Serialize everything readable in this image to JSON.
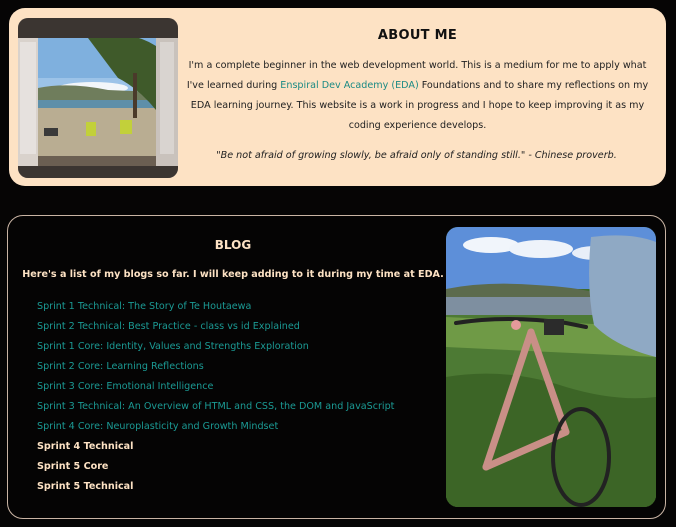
{
  "about": {
    "title": "ABOUT ME",
    "text_before_link": "I'm a complete beginner in the web development world. This is a medium for me to apply what I've learned during ",
    "link_text": "Enspiral Dev Academy (EDA)",
    "text_after_link": " Foundations and to share my reflections on my EDA learning journey. This website is a work in progress and I hope to keep improving it as my coding experience develops.",
    "quote": "\"Be not afraid of growing slowly, be afraid only of standing still.\" - Chinese proverb."
  },
  "blog": {
    "title": "BLOG",
    "intro": "Here's a list of my blogs so far. I will keep adding to it during my time at EDA.",
    "items": [
      {
        "label": "Sprint 1 Technical: The Story of Te Houtaewa",
        "linked": true
      },
      {
        "label": "Sprint 2 Technical: Best Practice - class vs id Explained",
        "linked": true
      },
      {
        "label": "Sprint 1 Core: Identity, Values and Strengths Exploration",
        "linked": true
      },
      {
        "label": "Sprint 2 Core: Learning Reflections",
        "linked": true
      },
      {
        "label": "Sprint 3 Core: Emotional Intelligence",
        "linked": true
      },
      {
        "label": "Sprint 3 Technical: An Overview of HTML and CSS, the DOM and JavaScript",
        "linked": true
      },
      {
        "label": "Sprint 4 Core: Neuroplasticity and Growth Mindset",
        "linked": true
      },
      {
        "label": "Sprint 4 Technical",
        "linked": false
      },
      {
        "label": "Sprint 5 Core",
        "linked": false
      },
      {
        "label": "Sprint 5 Technical",
        "linked": false
      }
    ]
  },
  "colors": {
    "background": "#060505",
    "about_card": "#fde2c4",
    "link": "#1b9a94",
    "cream_text": "#fde2c4",
    "blog_border": "#c9b4a4"
  }
}
